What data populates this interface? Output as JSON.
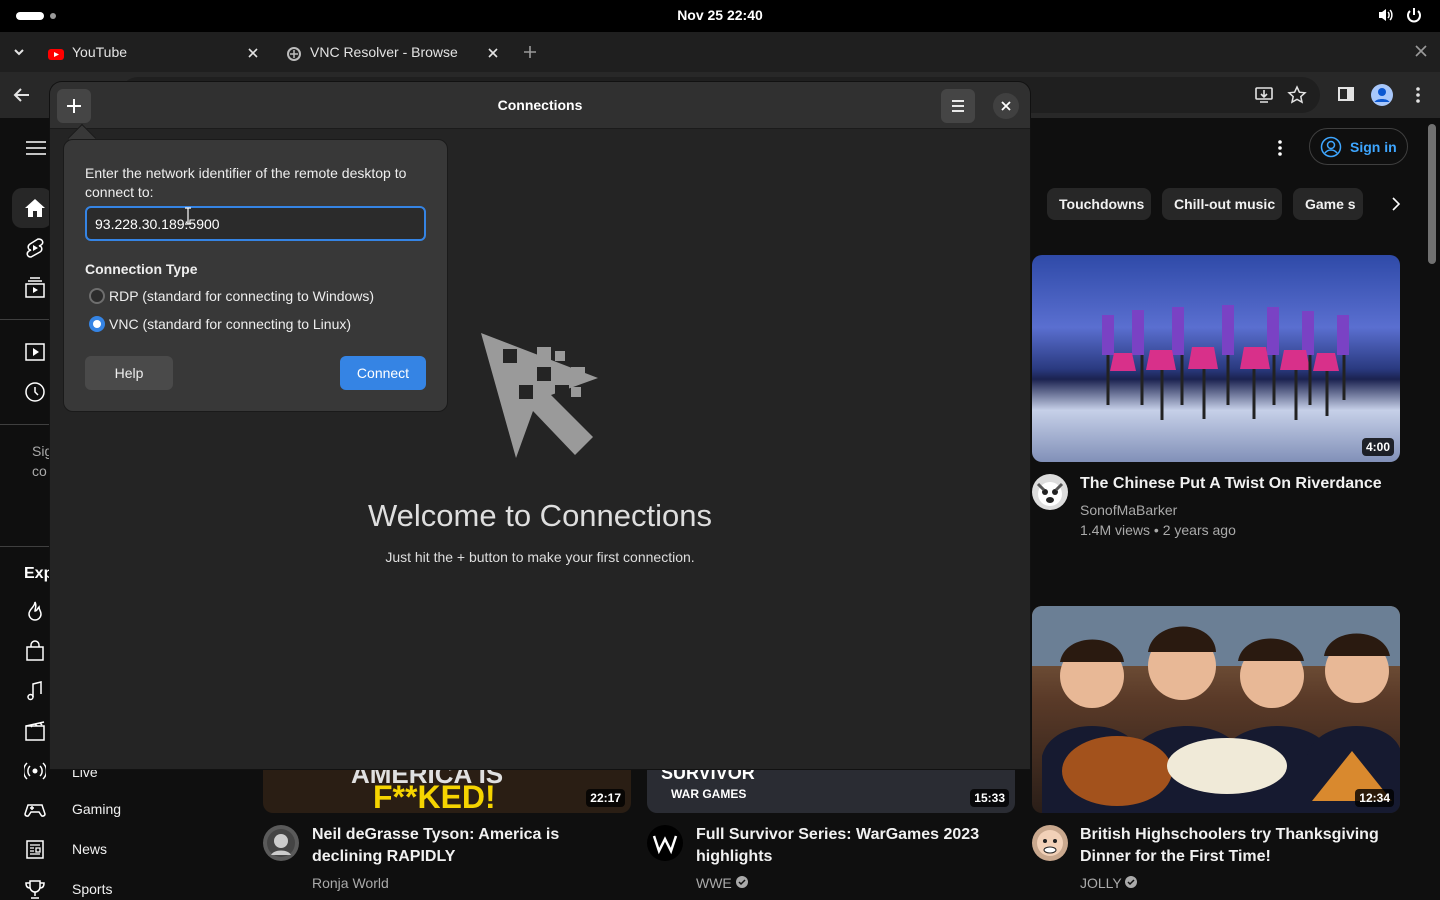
{
  "system": {
    "clock": "Nov 25  22:40"
  },
  "browser": {
    "tabs": [
      {
        "title": "YouTube",
        "favicon": "youtube-icon"
      },
      {
        "title": "VNC Resolver - Browse",
        "favicon": "vnc-icon"
      }
    ]
  },
  "youtube": {
    "sign_in": "Sign in",
    "chips": [
      "Touchdowns",
      "Chill-out music",
      "Game s"
    ],
    "sidebar_fragments": {
      "signin_a": "Sig",
      "signin_b": "co",
      "explore": "Exp",
      "live": "Live"
    },
    "sidebar_items": [
      "Gaming",
      "News",
      "Sports"
    ],
    "videos": [
      {
        "title": "The Chinese Put A Twist On Riverdance",
        "channel": "SonofMaBarker",
        "meta": "1.4M views • 2 years ago",
        "duration": "4:00"
      },
      {
        "title": "British Highschoolers try Thanksgiving Dinner for the First Time!",
        "channel": "JOLLY",
        "duration": "12:34"
      },
      {
        "title": "Neil deGrasse Tyson: America is declining RAPIDLY",
        "channel": "Ronja World",
        "duration": "22:17",
        "thumb_text": "F**KED!",
        "thumb_text_top": "AMERICA IS"
      },
      {
        "title": "Full Survivor Series: WarGames 2023 highlights",
        "channel": "WWE",
        "duration": "15:33",
        "thumb_text": "WAR GAMES",
        "thumb_text_top": "SURVIVOR"
      }
    ]
  },
  "connections": {
    "title": "Connections",
    "prompt": "Enter the network identifier of the remote desktop to connect to:",
    "address_value": "93.228.30.189:5900",
    "section": "Connection Type",
    "options": [
      {
        "label": "RDP (standard for connecting to Windows)",
        "selected": false
      },
      {
        "label": "VNC (standard for connecting to Linux)",
        "selected": true
      }
    ],
    "help": "Help",
    "connect": "Connect",
    "welcome_title": "Welcome to Connections",
    "welcome_sub": "Just hit the + button to make your first connection.",
    "accent": "#3584e4"
  }
}
